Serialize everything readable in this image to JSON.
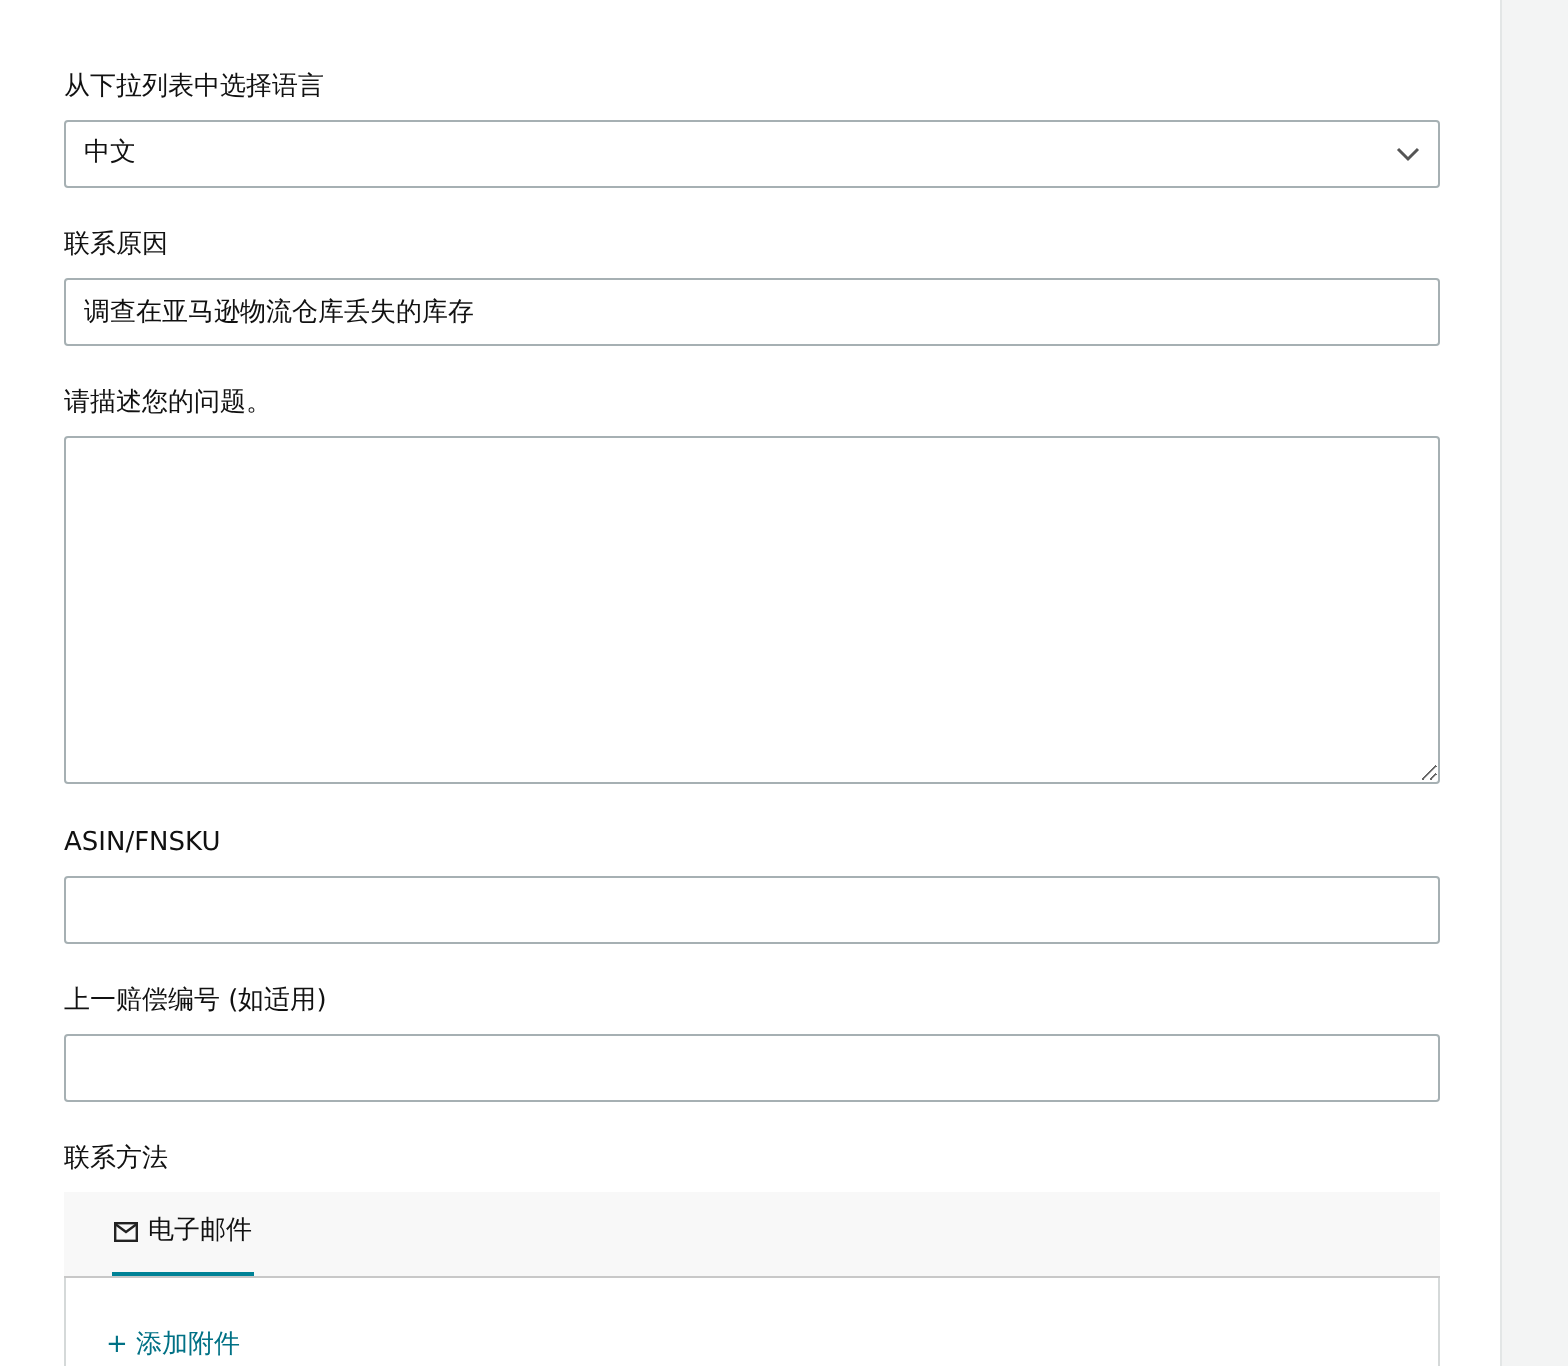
{
  "language": {
    "label": "从下拉列表中选择语言",
    "value": "中文"
  },
  "reason": {
    "label": "联系原因",
    "value": "调查在亚马逊物流仓库丢失的库存"
  },
  "description": {
    "label": "请描述您的问题。"
  },
  "asin": {
    "label": "ASIN/FNSKU"
  },
  "claim": {
    "label": "上一赔偿编号 (如适用)"
  },
  "contact": {
    "label": "联系方法",
    "tabs": [
      {
        "label": "电子邮件",
        "selected": true
      }
    ],
    "attach": "+ 添加附件"
  }
}
